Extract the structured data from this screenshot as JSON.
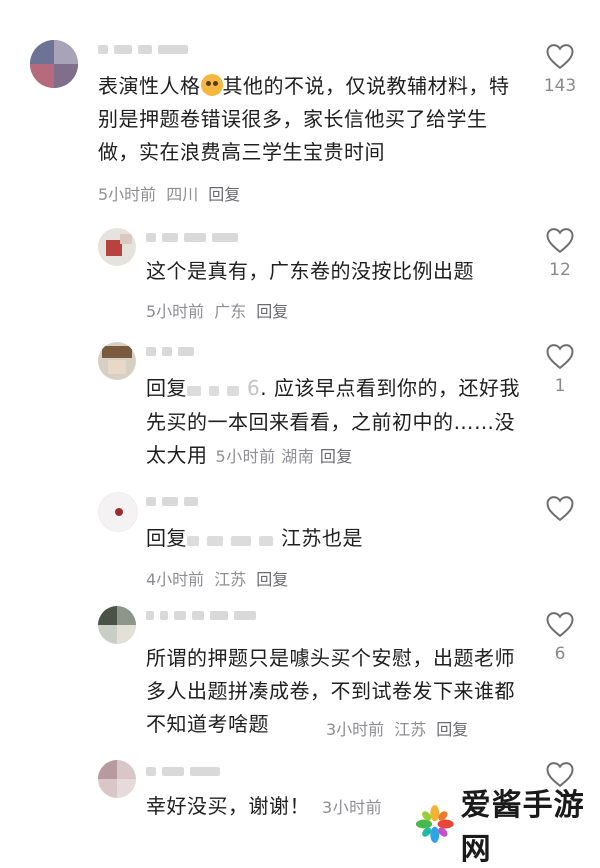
{
  "comments": [
    {
      "text_a": "表演性人格",
      "text_b": "其他的不说，仅说教辅材料，特别是押题卷错误很多，家长信他买了给学生做，实在浪费高三学生宝贵时间",
      "time": "5小时前",
      "location": "四川",
      "reply_label": "回复",
      "likes": "143"
    },
    {
      "text": "这个是真有，广东卷的没按比例出题",
      "time": "5小时前",
      "location": "广东",
      "reply_label": "回复",
      "likes": "12"
    },
    {
      "text_prefix": "回复",
      "text_masked_tail": "6",
      "text_body": ". 应该早点看到你的，还好我先买的一本回来看看，之前初中的……没太大用",
      "time": "5小时前",
      "location": "湖南",
      "reply_label": "回复",
      "likes": "1"
    },
    {
      "text_prefix": "回复",
      "text_body": "江苏也是",
      "time": "4小时前",
      "location": "江苏",
      "reply_label": "回复",
      "likes": ""
    },
    {
      "text": "所谓的押题只是噱头买个安慰，出题老师多人出题拼凑成卷，不到试卷发下来谁都不知道考啥题",
      "time": "3小时前",
      "location": "江苏",
      "reply_label": "回复",
      "likes": "6"
    },
    {
      "text": "幸好没买，谢谢！",
      "time": "3小时前",
      "likes": ""
    }
  ],
  "watermark": {
    "text": "爱酱手游网"
  },
  "icons": {
    "like": "heart-outline-icon",
    "logo": "pinwheel-logo-icon"
  },
  "colors": {
    "meta": "#8e8e93",
    "text": "#1f1f1f",
    "heart_stroke": "#6e6e6e"
  }
}
